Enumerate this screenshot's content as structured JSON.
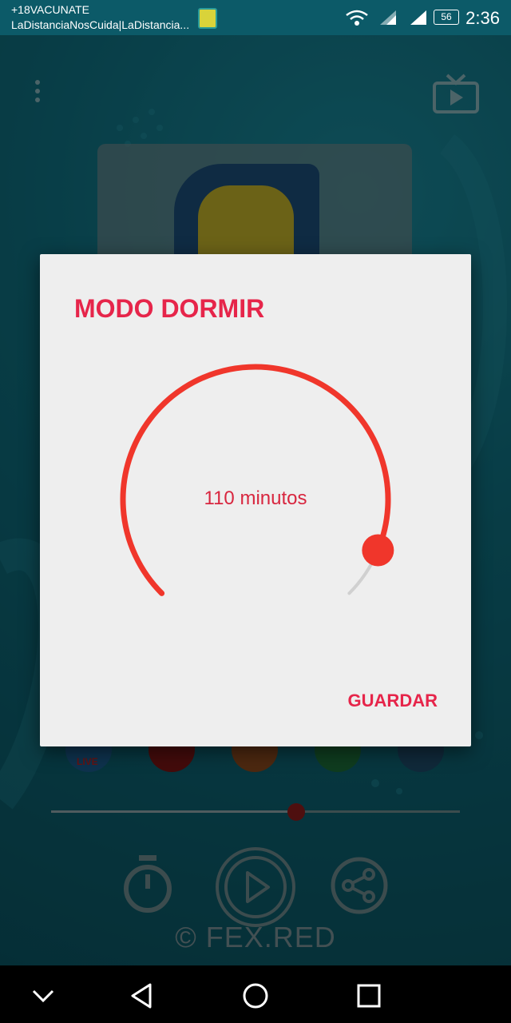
{
  "status_bar": {
    "notification_line1": "+18VACUNATE",
    "notification_line2": "LaDistanciaNosCuida|LaDistancia...",
    "battery": "56",
    "time": "2:36"
  },
  "player": {
    "progress": 0.6,
    "copyright": "© FEX.RED",
    "social_icons": [
      "facebook-live-icon",
      "youtube-icon",
      "instagram-icon",
      "whatsapp-icon",
      "web-globe-icon"
    ],
    "live_label": "LIVE"
  },
  "dialog": {
    "title": "MODO DORMIR",
    "value_label": "110 minutos",
    "value_minutes": 110,
    "save_label": "GUARDAR",
    "accent_color": "#f0362b"
  },
  "nav_bar": {
    "icons": [
      "chevron-down-icon",
      "back-icon",
      "home-icon",
      "recents-icon"
    ]
  }
}
